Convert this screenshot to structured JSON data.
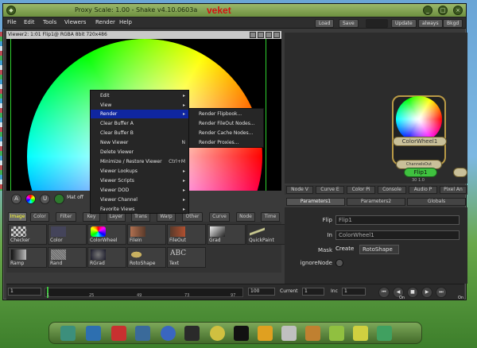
{
  "window": {
    "title": "Proxy Scale: 1.00 - Shake v4.10.0603a",
    "user": "veket",
    "top_buttons": [
      "Load",
      "Save",
      "Update",
      "always",
      "Bkgd"
    ]
  },
  "menubar": [
    "File",
    "Edit",
    "Tools",
    "Viewers",
    "Render",
    "Help"
  ],
  "viewer": {
    "header": "Viewer2: 1:01 Flip1@ RGBA 8bit 720x486",
    "tools": {
      "buttons": [
        "A",
        "U"
      ],
      "mat_label": "Mat off"
    }
  },
  "context_menu": {
    "items": [
      {
        "label": "Edit",
        "arrow": "▸"
      },
      {
        "label": "View",
        "arrow": "▸"
      },
      {
        "label": "Render",
        "arrow": "▸"
      },
      {
        "label": "Clear Buffer A"
      },
      {
        "label": "Clear Buffer B"
      },
      {
        "label": "New Viewer",
        "shortcut": "N"
      },
      {
        "label": "Delete Viewer"
      },
      {
        "label": "Minimize / Restore Viewer",
        "shortcut": "Ctrl+M"
      },
      {
        "label": "Viewer Lookups",
        "arrow": "▸"
      },
      {
        "label": "Viewer Scripts",
        "arrow": "▸"
      },
      {
        "label": "Viewer DOD",
        "arrow": "▸"
      },
      {
        "label": "Viewer Channel",
        "arrow": "▸"
      },
      {
        "label": "Favorite Views",
        "arrow": "▸"
      }
    ],
    "highlighted_index": 2,
    "submenu": [
      "Render Flipbook...",
      "Render FileOut Nodes...",
      "Render Cache Nodes...",
      "Render Proxies..."
    ]
  },
  "tool_tabs": [
    "Image",
    "Color",
    "Filter",
    "Key",
    "Layer",
    "Trans",
    "Warp",
    "Other",
    "Curve",
    "Node",
    "Time"
  ],
  "tool_tabs_active": "Image",
  "tools": [
    {
      "label": "Checker",
      "color": "#8a8aa8"
    },
    {
      "label": "Color",
      "color": "#44445a"
    },
    {
      "label": "ColorWheel",
      "color": "#8f7fb8"
    },
    {
      "label": "FileIn",
      "color": "#b07050"
    },
    {
      "label": "FileOut",
      "color": "#b05030"
    },
    {
      "label": "Grad",
      "color": "#909090"
    },
    {
      "label": "QuickPaint",
      "color": "#c8c890"
    },
    {
      "label": "Ramp",
      "color": "#6a6a7a"
    },
    {
      "label": "Rand",
      "color": "#7a7a7a"
    },
    {
      "label": "RGrad",
      "color": "#2a2a3a"
    },
    {
      "label": "RotoShape",
      "color": "#c8b060"
    },
    {
      "label": "Text",
      "color": "#cfcfcf",
      "glyph": "ABC"
    }
  ],
  "timeline": {
    "start": "1",
    "ticks": [
      "1",
      "25",
      "49",
      "73",
      "97"
    ],
    "end": "100",
    "current_label": "Current",
    "current": "1",
    "inc_label": "Inc",
    "inc": "1",
    "play_buttons": [
      "⏮",
      "◀",
      "■",
      "▶",
      "⏭"
    ],
    "on_labels": [
      "On",
      "On"
    ]
  },
  "nodes": {
    "colorwheel": "ColorWheel1",
    "flip": "Flip1",
    "flip_hidden_label": "ChannelsOut",
    "flip_sub": "30 1.0"
  },
  "panel_tabs": [
    "Node V",
    "Curve E",
    "Color Pi",
    "Console",
    "Audio P",
    "Pixel An"
  ],
  "param_tabs": [
    "Parameters1",
    "Parameters2",
    "Globals"
  ],
  "params": {
    "flip_label": "Flip",
    "flip_value": "Flip1",
    "in_label": "In",
    "in_value": "ColorWheel1",
    "mask_label": "Mask",
    "create_label": "Create",
    "rotoshape_label": "RotoShape",
    "ignore_label": "ignoreNode"
  },
  "taskbar": {
    "colors": [
      "#3c8f7c",
      "#2d6fb0",
      "#c83030",
      "#3a6a9a",
      "#3a66c0",
      "#2a2a2a",
      "#d0c040",
      "#111111",
      "#e0a020",
      "#c0c0c0",
      "#c08030",
      "#90c040",
      "#d0d040",
      "#40a060"
    ]
  },
  "colors": {
    "menu_highlight": "#0f26a0",
    "node_accent": "#b99a46",
    "flip_node": "#3fc13f",
    "title_user": "#d21414"
  }
}
